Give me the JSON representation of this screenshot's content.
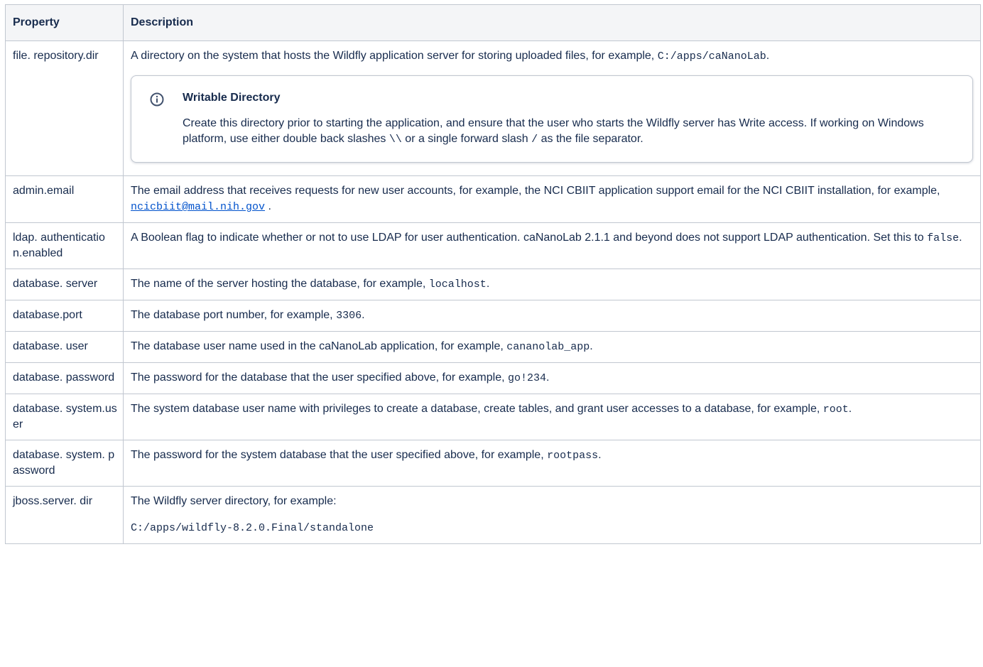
{
  "headers": {
    "property": "Property",
    "description": "Description"
  },
  "rows": {
    "file_repo": {
      "prop": "file. repository.dir",
      "desc_pre": "A directory on the system that hosts the Wildfly application server for storing uploaded files, for example, ",
      "code": "C:/apps/caNanoLab",
      "desc_post": ".",
      "panel": {
        "title": "Writable Directory",
        "body_1": "Create this directory prior to starting the application, and ensure that the user who starts the Wildfly server has Write access. If working on Windows platform, use either double back slashes ",
        "code_1": "\\\\",
        "body_2": " or a single forward slash ",
        "code_2": "/",
        "body_3": " as the file separator."
      }
    },
    "admin_email": {
      "prop": "admin.email",
      "desc_pre": "The email address that receives requests for new user accounts, for example, the NCI CBIIT application support email for the NCI CBIIT installation, for example, ",
      "link": "ncicbiit@mail.nih.gov",
      "desc_post": " ."
    },
    "ldap": {
      "prop": "ldap. authenticatio n.enabled",
      "desc_pre": "A Boolean flag to indicate whether or not to use LDAP for user authentication. caNanoLab 2.1.1 and beyond does not support LDAP authentication. Set this to ",
      "code": "false",
      "desc_post": "."
    },
    "db_server": {
      "prop": "database. server",
      "desc_pre": "The name of the server hosting the database, for example, ",
      "code": "localhost",
      "desc_post": "."
    },
    "db_port": {
      "prop": "database.port",
      "desc_pre": "The database port number, for example, ",
      "code": "3306",
      "desc_post": "."
    },
    "db_user": {
      "prop": "database. user",
      "desc_pre": "The database user name used in the caNanoLab application, for example, ",
      "code": "cananolab_app",
      "desc_post": "."
    },
    "db_password": {
      "prop": "database. password",
      "desc_pre": "The password for the database that the user specified above, for example, ",
      "code": "go!234",
      "desc_post": "."
    },
    "db_sys_user": {
      "prop": "database. system.user",
      "desc_pre": "The system database user name with privileges to create a database, create tables, and grant user accesses to a database, for example, ",
      "code": "root",
      "desc_post": "."
    },
    "db_sys_password": {
      "prop": "database. system. password",
      "desc_pre": "The password for the system database that the user specified above, for example, ",
      "code": "rootpass",
      "desc_post": "."
    },
    "jboss_dir": {
      "prop": "jboss.server. dir",
      "desc_pre": "The Wildfly server directory, for example:",
      "code": "C:/apps/wildfly-8.2.0.Final/standalone"
    }
  }
}
